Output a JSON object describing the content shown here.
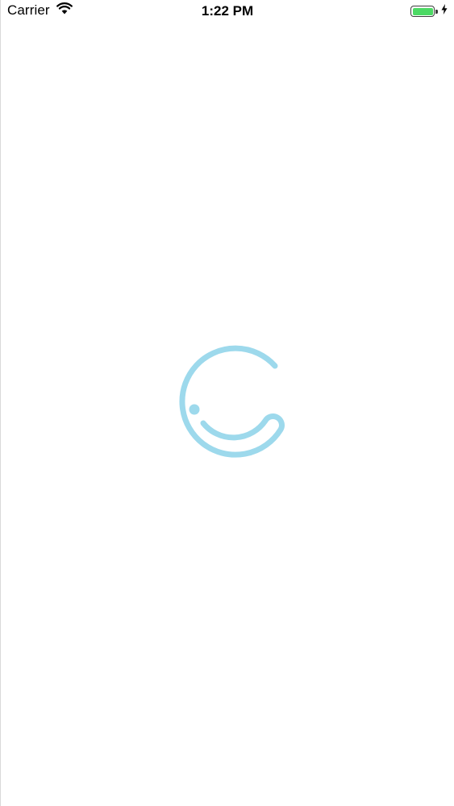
{
  "status_bar": {
    "carrier": "Carrier",
    "time": "1:22 PM",
    "battery_level": 1.0,
    "charging": true,
    "icons": {
      "wifi": "wifi-icon",
      "battery": "battery-icon",
      "charging": "charging-bolt-icon"
    }
  },
  "splash": {
    "logo_icon": "smiley-logo-icon",
    "accent_color": "#9dd9ec"
  },
  "colors": {
    "background": "#ffffff",
    "battery_fill": "#4cd964"
  }
}
